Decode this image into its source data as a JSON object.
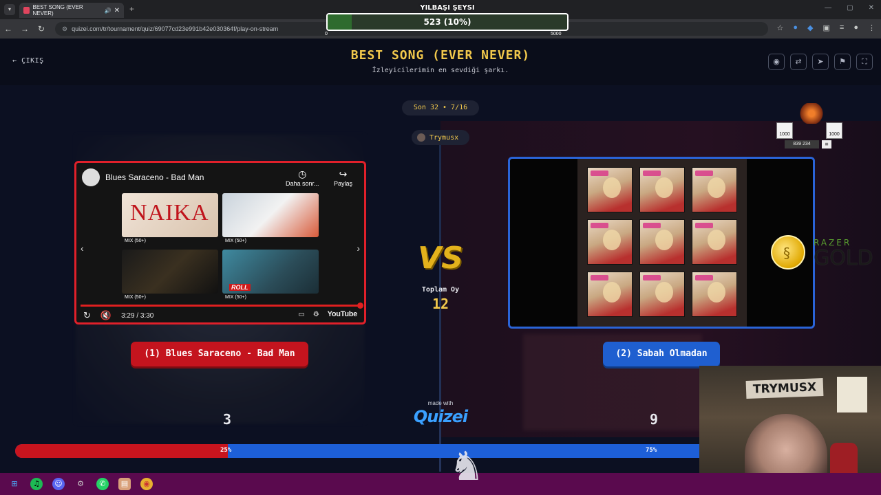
{
  "browser": {
    "tab_title": "BEST SONG (EVER NEVER)",
    "tab_close": "✕",
    "new_tab": "+",
    "url": "quizei.com/tr/tournament/quiz/69077cd23e991b42e030364f/play-on-stream"
  },
  "overlay": {
    "title": "YILBAŞI ŞEYSI",
    "value_text": "523 (10%)",
    "progress": 0.1,
    "min": "0",
    "max": "5000"
  },
  "header": {
    "exit": "ÇIKIŞ",
    "title": "BEST SONG (EVER NEVER)",
    "subtitle": "İzleyicilerimin en sevdiği şarkı."
  },
  "round": "Son 32 • 7/16",
  "user": "Trymusx",
  "vs": "VS",
  "total_label": "Toplam Oy",
  "total_value": "12",
  "left": {
    "video_title": "Blues Saraceno - Bad Man",
    "watch_later": "Daha sonr...",
    "share": "Paylaş",
    "thumb_word": "NAIKA",
    "roll": "ROLL",
    "mix": "MIX (50+)",
    "time": "3:29 / 3:30",
    "yt": "YouTube",
    "answer": "(1) Blues Saraceno - Bad Man",
    "votes": "3",
    "percent": "25%",
    "color": "#c8141e"
  },
  "right": {
    "answer": "(2) Sabah Olmadan",
    "votes": "9",
    "percent": "75%",
    "color": "#1d5fd8"
  },
  "made_with": "made with",
  "brand": "Quizei",
  "sponsor": {
    "razer": "RAZER",
    "gold": "GOLD"
  },
  "widget": {
    "left_label": "1000",
    "right_label": "1000",
    "count": "839 234"
  },
  "cam": {
    "sign": "TRYMUSX"
  }
}
